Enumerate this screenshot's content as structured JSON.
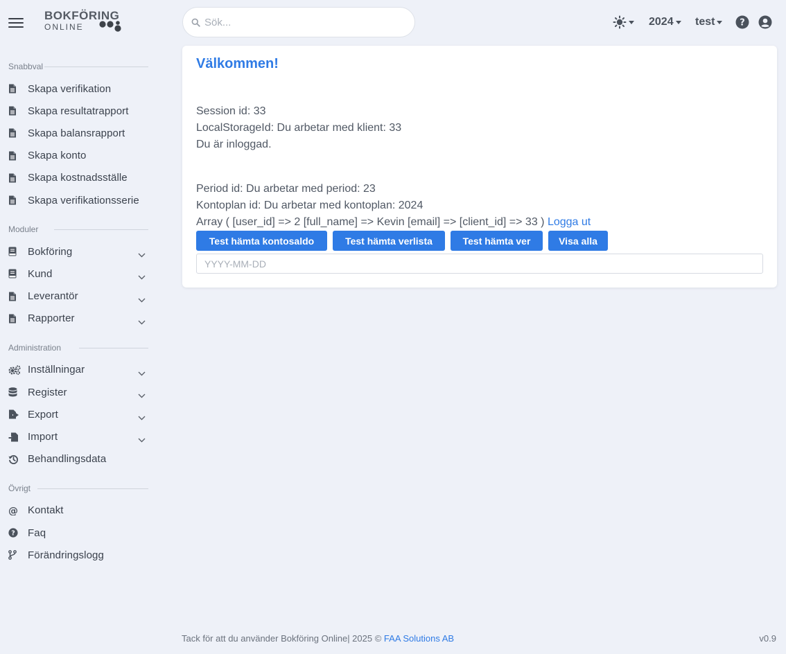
{
  "logo": {
    "line1": "BOKFÖRING",
    "line2": "ONLINE"
  },
  "search": {
    "placeholder": "Sök..."
  },
  "topbar": {
    "year": "2024",
    "user": "test"
  },
  "colors": {
    "accent": "#2f7be5",
    "background": "#eef1f8",
    "text": "#3c4452"
  },
  "sidebar": {
    "sections": [
      {
        "title": "Snabbval",
        "items": [
          {
            "label": "Skapa verifikation",
            "icon": "document-icon"
          },
          {
            "label": "Skapa resultatrapport",
            "icon": "document-icon"
          },
          {
            "label": "Skapa balansrapport",
            "icon": "document-icon"
          },
          {
            "label": "Skapa konto",
            "icon": "document-icon"
          },
          {
            "label": "Skapa kostnadsställe",
            "icon": "document-icon"
          },
          {
            "label": "Skapa verifikationsserie",
            "icon": "document-icon"
          }
        ]
      },
      {
        "title": "Moduler",
        "items": [
          {
            "label": "Bokföring",
            "icon": "book-icon",
            "expandable": true
          },
          {
            "label": "Kund",
            "icon": "book-icon",
            "expandable": true
          },
          {
            "label": "Leverantör",
            "icon": "document-icon",
            "expandable": true
          },
          {
            "label": "Rapporter",
            "icon": "document-icon",
            "expandable": true
          }
        ]
      },
      {
        "title": "Administration",
        "items": [
          {
            "label": "Inställningar",
            "icon": "gears-icon",
            "expandable": true
          },
          {
            "label": "Register",
            "icon": "database-icon",
            "expandable": true
          },
          {
            "label": "Export",
            "icon": "file-export-icon",
            "expandable": true
          },
          {
            "label": "Import",
            "icon": "file-import-icon",
            "expandable": true
          },
          {
            "label": "Behandlingsdata",
            "icon": "history-icon"
          }
        ]
      },
      {
        "title": "Övrigt",
        "items": [
          {
            "label": "Kontakt",
            "icon": "at-icon"
          },
          {
            "label": "Faq",
            "icon": "question-circle-icon"
          },
          {
            "label": "Förändringslogg",
            "icon": "code-branch-icon"
          }
        ]
      }
    ]
  },
  "main": {
    "title": "Välkommen!",
    "session": "Session id: 33",
    "local_storage": "LocalStorageId: Du arbetar med klient: 33",
    "logged_in": "Du är inloggad.",
    "period": "Period id: Du arbetar med period: 23",
    "kontoplan": "Kontoplan id: Du arbetar med kontoplan: 2024",
    "array_text": "Array ( [user_id] => 2 [full_name] => Kevin [email] => [client_id] => 33 )",
    "logout_link": "Logga ut",
    "buttons": {
      "kontosaldo": "Test hämta kontosaldo",
      "verlista": "Test hämta verlista",
      "ver": "Test hämta ver",
      "visa_alla": "Visa alla"
    },
    "date_placeholder": "YYYY-MM-DD"
  },
  "footer": {
    "text": "Tack för att du använder Bokföring Online| 2025 ©",
    "link": "FAA Solutions AB",
    "version": "v0.9"
  }
}
